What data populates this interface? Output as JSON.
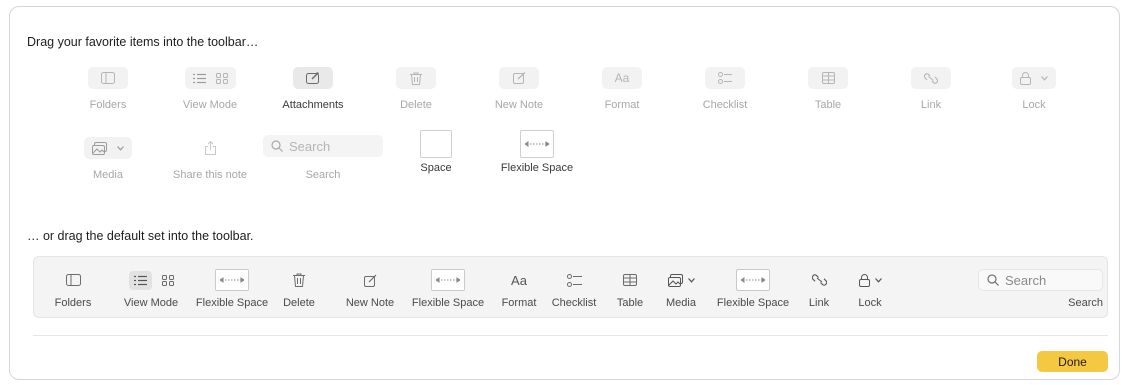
{
  "dialog": {
    "palette_heading": "Drag your favorite items into the toolbar…",
    "default_heading": "… or drag the default set into the toolbar.",
    "done_label": "Done"
  },
  "palette": {
    "folders": "Folders",
    "view_mode": "View Mode",
    "attachments": "Attachments",
    "delete": "Delete",
    "new_note": "New Note",
    "format": "Format",
    "format_glyph": "Aa",
    "checklist": "Checklist",
    "table": "Table",
    "link": "Link",
    "lock": "Lock",
    "media": "Media",
    "share": "Share this note",
    "search": "Search",
    "search_placeholder": "Search",
    "space": "Space",
    "flexible_space": "Flexible Space"
  },
  "toolbar": {
    "folders": "Folders",
    "view_mode": "View Mode",
    "flex1": "Flexible Space",
    "delete": "Delete",
    "new_note": "New Note",
    "flex2": "Flexible Space",
    "format": "Format",
    "format_glyph": "Aa",
    "checklist": "Checklist",
    "table": "Table",
    "media": "Media",
    "flex3": "Flexible Space",
    "link": "Link",
    "lock": "Lock",
    "search": "Search",
    "search_placeholder": "Search",
    "overflow_glyph": "»"
  }
}
